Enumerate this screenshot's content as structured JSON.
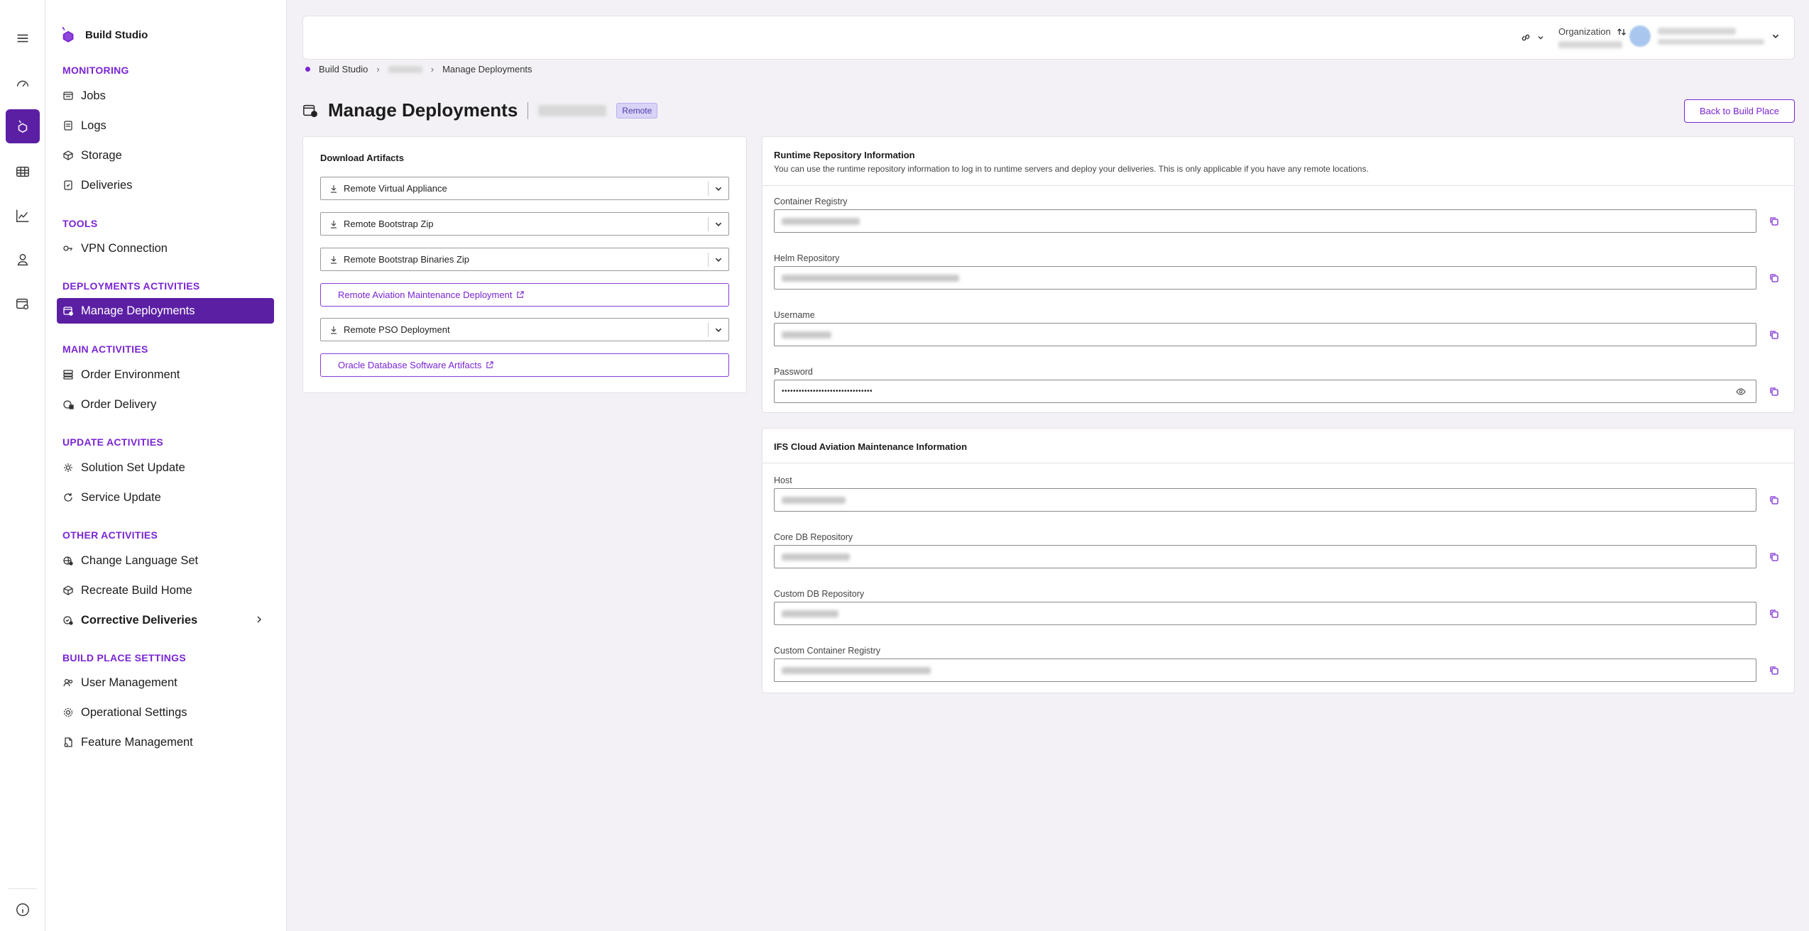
{
  "app": {
    "name": "Build Studio",
    "accent": "#7a25d4",
    "active_bg": "#5b1fa4"
  },
  "rail": {
    "icons": [
      "menu-icon",
      "gauge-icon",
      "build-studio-icon",
      "table-icon",
      "chart-icon",
      "person-icon",
      "calendar-gear-icon",
      "info-icon"
    ]
  },
  "sidebar": {
    "sections": {
      "monitoring": "MONITORING",
      "tools": "TOOLS",
      "deployments": "DEPLOYMENTS ACTIVITIES",
      "main": "MAIN ACTIVITIES",
      "update": "UPDATE ACTIVITIES",
      "other": "OTHER ACTIVITIES",
      "settings": "BUILD PLACE SETTINGS"
    },
    "items": {
      "jobs": "Jobs",
      "logs": "Logs",
      "storage": "Storage",
      "deliveries": "Deliveries",
      "vpn": "VPN Connection",
      "manage_deployments": "Manage Deployments",
      "order_environment": "Order Environment",
      "order_delivery": "Order Delivery",
      "solution_set_update": "Solution Set Update",
      "service_update": "Service Update",
      "change_language_set": "Change Language Set",
      "recreate_build_home": "Recreate Build Home",
      "corrective_deliveries": "Corrective Deliveries",
      "user_management": "User Management",
      "operational_settings": "Operational Settings",
      "feature_management": "Feature Management"
    }
  },
  "topbar": {
    "organization_label": "Organization"
  },
  "breadcrumb": {
    "root": "Build Studio",
    "current": "Manage Deployments"
  },
  "page": {
    "title": "Manage Deployments",
    "badge": "Remote",
    "back_button": "Back to Build Place"
  },
  "downloads": {
    "title": "Download Artifacts",
    "items": [
      {
        "label": "Remote Virtual Appliance"
      },
      {
        "label": "Remote Bootstrap Zip"
      },
      {
        "label": "Remote Bootstrap Binaries Zip"
      },
      {
        "label": "Remote Aviation Maintenance Deployment"
      },
      {
        "label": "Remote PSO Deployment"
      },
      {
        "label": "Oracle Database Software Artifacts"
      }
    ]
  },
  "runtime": {
    "title": "Runtime Repository Information",
    "description": "You can use the runtime repository information to log in to runtime servers and deploy your deliveries. This is only applicable if you have any remote locations.",
    "fields": {
      "container_registry": "Container Registry",
      "helm_repository": "Helm Repository",
      "username": "Username",
      "password": "Password",
      "password_value": "••••••••••••••••••••••••••••••••"
    }
  },
  "aviation": {
    "title": "IFS Cloud Aviation Maintenance Information",
    "fields": {
      "host": "Host",
      "core_db_repository": "Core DB Repository",
      "custom_db_repository": "Custom DB Repository",
      "custom_container_registry": "Custom Container Registry"
    }
  }
}
